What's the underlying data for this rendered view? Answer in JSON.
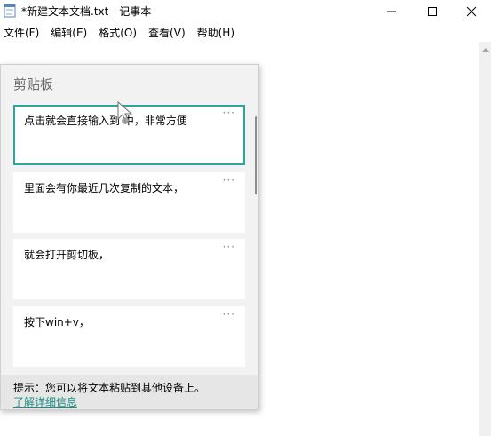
{
  "window": {
    "title": "*新建文本文档.txt - 记事本",
    "buttons": [
      "minimize",
      "maximize",
      "close"
    ]
  },
  "menu": [
    {
      "label": "文件(F)"
    },
    {
      "label": "编辑(E)"
    },
    {
      "label": "格式(O)"
    },
    {
      "label": "查看(V)"
    },
    {
      "label": "帮助(H)"
    }
  ],
  "clipboard": {
    "header": "剪贴板",
    "more_glyph": "···",
    "items": [
      {
        "text": "点击就会直接输入到 中，非常方便",
        "selected": true
      },
      {
        "text": "里面会有你最近几次复制的文本，",
        "selected": false
      },
      {
        "text": "就会打开剪切板，",
        "selected": false
      },
      {
        "text": "按下win+v，",
        "selected": false
      }
    ],
    "tip": "提示：您可以将文本粘贴到其他设备上。",
    "learn_more": "了解详细信息"
  },
  "colors": {
    "accent": "#2aa79b",
    "link": "#1a8f86",
    "panel_bg": "#f2f2f2",
    "footer_bg": "#e6e6e6"
  },
  "icons": {
    "app": "notepad-icon",
    "minimize": "minimize-icon",
    "maximize": "maximize-icon",
    "close": "close-icon",
    "more": "more-options-icon",
    "cursor": "mouse-cursor-icon"
  }
}
